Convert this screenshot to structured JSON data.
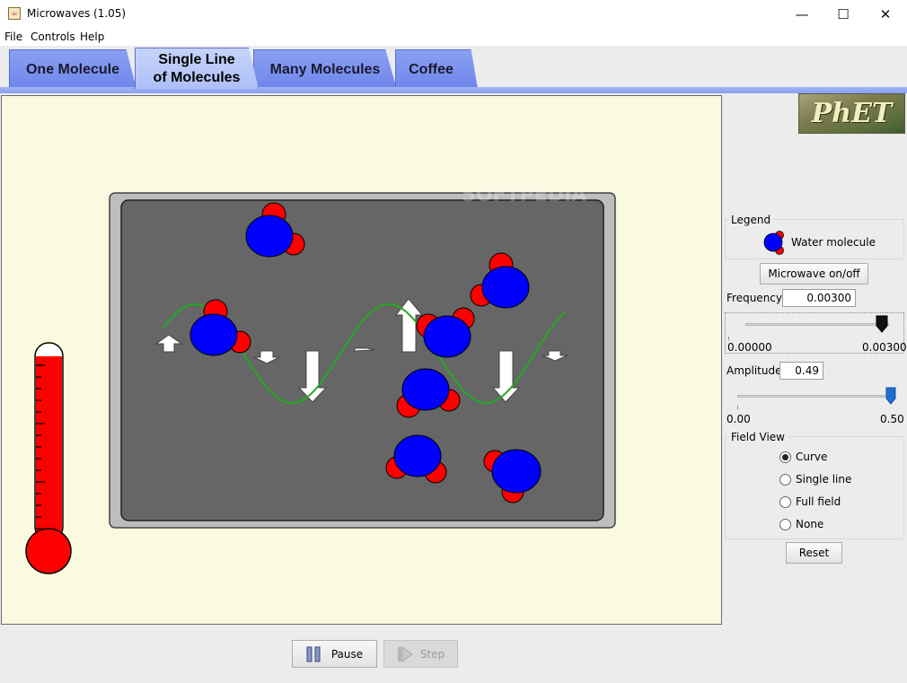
{
  "window": {
    "title": "Microwaves (1.05)",
    "minimize": "—",
    "maximize": "☐",
    "close": "✕"
  },
  "menu": [
    "File",
    "Controls",
    "Help"
  ],
  "tabs": [
    {
      "label": "One Molecule"
    },
    {
      "label": "Single Line\nof Molecules",
      "active": true
    },
    {
      "label": "Many Molecules"
    },
    {
      "label": "Coffee"
    }
  ],
  "logo": {
    "text": "PhET"
  },
  "watermark": "SOFTPEDIA",
  "legend": {
    "title": "Legend",
    "item": "Water molecule"
  },
  "microwave_button": "Microwave on/off",
  "frequency": {
    "label": "Frequency",
    "value": "0.00300",
    "min": "0.00000",
    "max": "0.00300",
    "level": 1.0
  },
  "amplitude": {
    "label": "Amplitude",
    "value": "0.49",
    "min": "0.00",
    "max": "0.50",
    "level": 0.98
  },
  "field_view": {
    "title": "Field View",
    "options": [
      {
        "label": "Curve",
        "selected": true
      },
      {
        "label": "Single line",
        "selected": false
      },
      {
        "label": "Full field",
        "selected": false
      },
      {
        "label": "None",
        "selected": false
      }
    ]
  },
  "reset_button": "Reset",
  "pause_button": "Pause",
  "step_button": "Step",
  "colors": {
    "oven": "#666666",
    "field_curve": "#22aa22",
    "oxygen": "#0000ff",
    "hydrogen": "#ff0000",
    "thermometer": "#ff0000",
    "canvas": "#fafae0",
    "tab": "#7f95ef",
    "tab_active": "#b8c8f9"
  }
}
